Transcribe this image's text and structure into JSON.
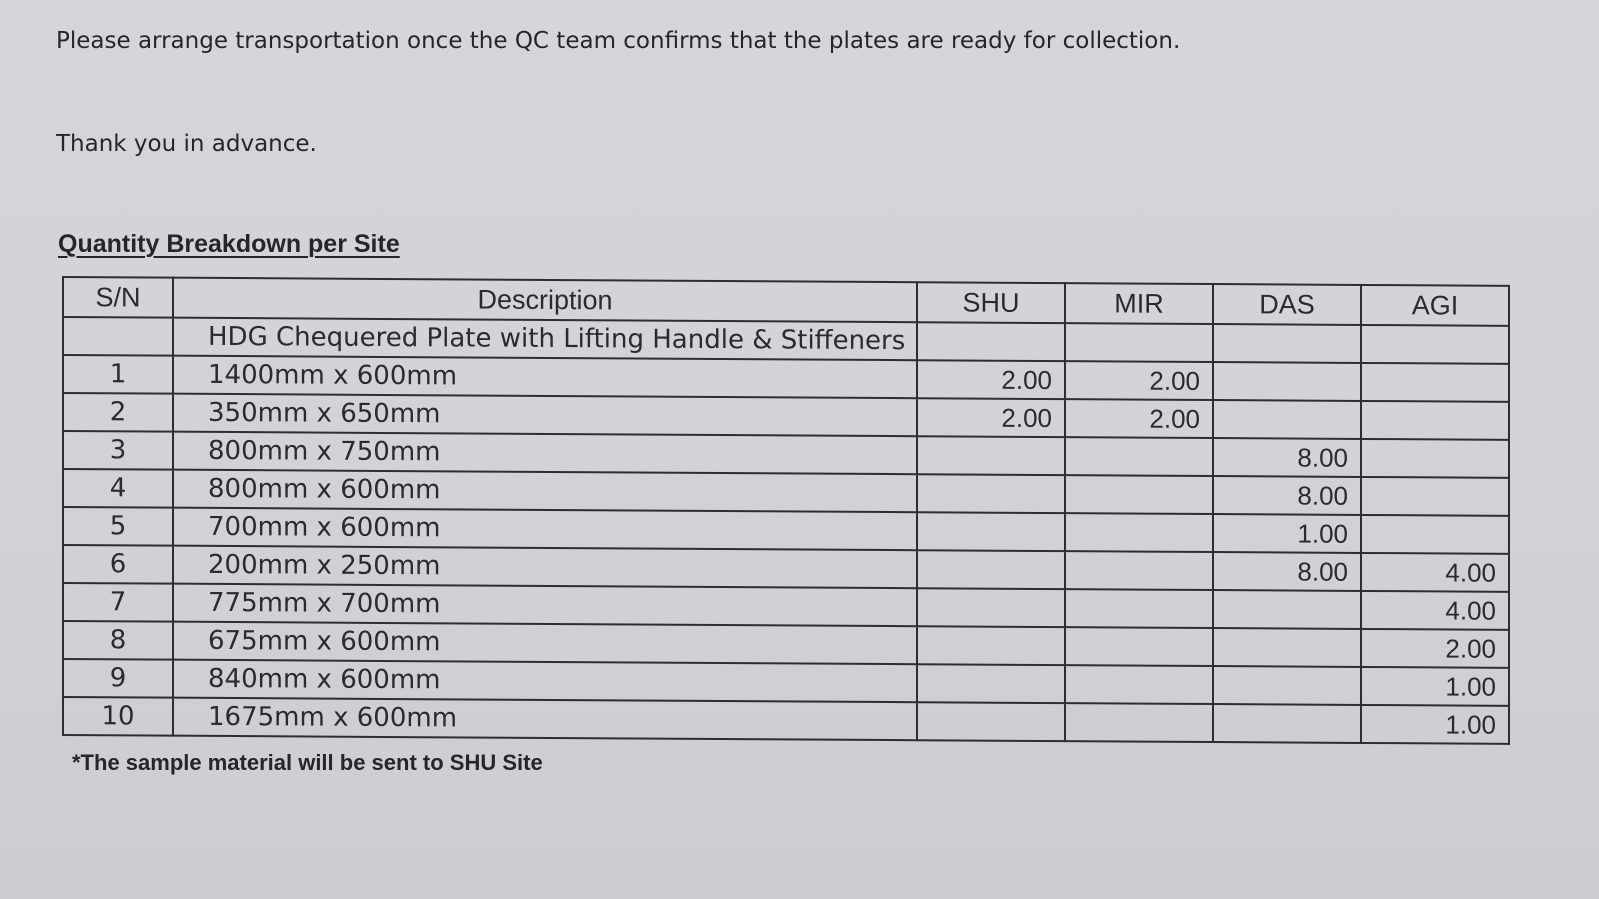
{
  "intro": "Please arrange transportation once the QC team confirms that the plates are ready for collection.",
  "thanks": "Thank you in advance.",
  "table_heading": "Quantity Breakdown per Site",
  "table": {
    "headers": [
      "S/N",
      "Description",
      "SHU",
      "MIR",
      "DAS",
      "AGI"
    ],
    "group_row": {
      "sn": "",
      "description": "HDG Chequered Plate with Lifting Handle & Stiffeners",
      "shu": "",
      "mir": "",
      "das": "",
      "agi": ""
    },
    "rows": [
      {
        "sn": "1",
        "description": "1400mm x 600mm",
        "shu": "2.00",
        "mir": "2.00",
        "das": "",
        "agi": ""
      },
      {
        "sn": "2",
        "description": "350mm x 650mm",
        "shu": "2.00",
        "mir": "2.00",
        "das": "",
        "agi": ""
      },
      {
        "sn": "3",
        "description": "800mm x 750mm",
        "shu": "",
        "mir": "",
        "das": "8.00",
        "agi": ""
      },
      {
        "sn": "4",
        "description": "800mm x 600mm",
        "shu": "",
        "mir": "",
        "das": "8.00",
        "agi": ""
      },
      {
        "sn": "5",
        "description": "700mm x 600mm",
        "shu": "",
        "mir": "",
        "das": "1.00",
        "agi": ""
      },
      {
        "sn": "6",
        "description": "200mm x 250mm",
        "shu": "",
        "mir": "",
        "das": "8.00",
        "agi": "4.00"
      },
      {
        "sn": "7",
        "description": "775mm x 700mm",
        "shu": "",
        "mir": "",
        "das": "",
        "agi": "4.00"
      },
      {
        "sn": "8",
        "description": "675mm x 600mm",
        "shu": "",
        "mir": "",
        "das": "",
        "agi": "2.00"
      },
      {
        "sn": "9",
        "description": "840mm x 600mm",
        "shu": "",
        "mir": "",
        "das": "",
        "agi": "1.00"
      },
      {
        "sn": "10",
        "description": "1675mm x 600mm",
        "shu": "",
        "mir": "",
        "das": "",
        "agi": "1.00"
      }
    ]
  },
  "footnote": "*The sample material will be sent to SHU Site"
}
